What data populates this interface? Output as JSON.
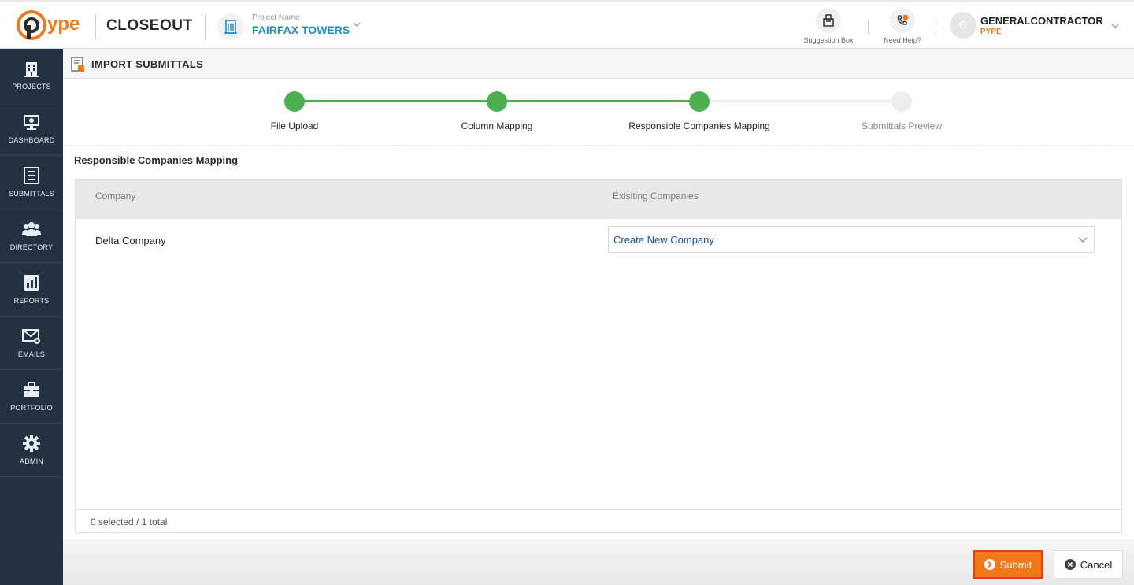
{
  "header": {
    "logo_text": "ype",
    "app_title": "CLOSEOUT",
    "project_label": "Project Name",
    "project_name": "FAIRFAX TOWERS",
    "suggestion_label": "Suggestion Box",
    "help_label": "Need Help?",
    "avatar_initial": "G",
    "user_name": "GENERALCONTRACTOR",
    "user_org": "PYPE"
  },
  "sidebar": {
    "items": [
      {
        "label": "PROJECTS",
        "icon": "building-icon"
      },
      {
        "label": "DASHBOARD",
        "icon": "monitor-icon"
      },
      {
        "label": "SUBMITTALS",
        "icon": "list-icon"
      },
      {
        "label": "DIRECTORY",
        "icon": "users-icon"
      },
      {
        "label": "REPORTS",
        "icon": "report-icon"
      },
      {
        "label": "EMAILS",
        "icon": "mail-icon"
      },
      {
        "label": "PORTFOLIO",
        "icon": "briefcase-icon"
      },
      {
        "label": "ADMIN",
        "icon": "gear-icon"
      }
    ]
  },
  "page": {
    "title": "IMPORT SUBMITTALS"
  },
  "stepper": {
    "steps": [
      {
        "label": "File Upload",
        "done": true
      },
      {
        "label": "Column Mapping",
        "done": true
      },
      {
        "label": "Responsible Companies Mapping",
        "done": true
      },
      {
        "label": "Submittals Preview",
        "done": false
      }
    ],
    "colors": {
      "done": "#4caf50",
      "pending": "#eeeeee"
    }
  },
  "section": {
    "title": "Responsible Companies Mapping"
  },
  "table": {
    "columns": [
      "Company",
      "Exisiting Companies"
    ],
    "rows": [
      {
        "company": "Delta Company",
        "existing": "Create New Company"
      }
    ],
    "footer": "0 selected / 1 total"
  },
  "actions": {
    "submit": "Submit",
    "cancel": "Cancel"
  }
}
